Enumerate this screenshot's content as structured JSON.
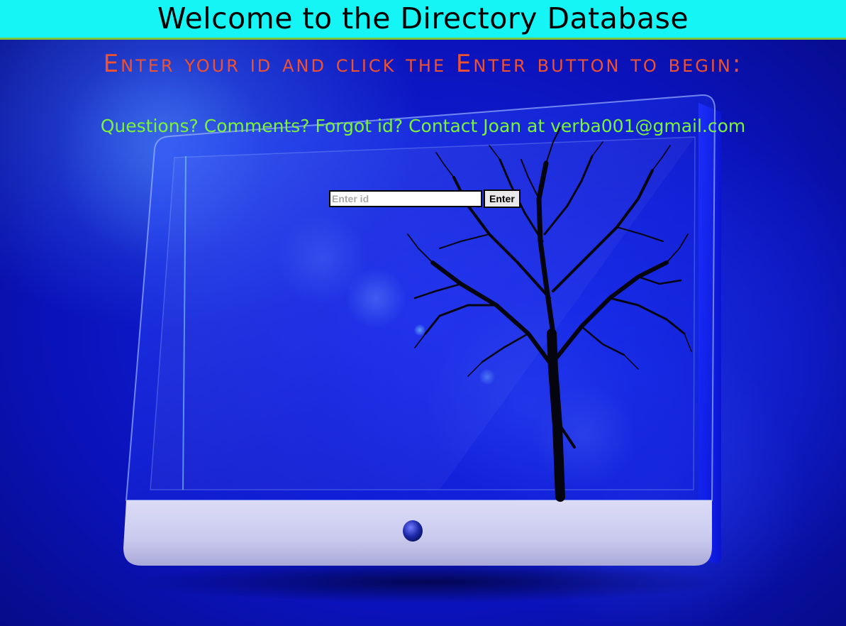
{
  "header": {
    "title": "Welcome to the Directory Database"
  },
  "instruction": {
    "text": "Enter your id and click the Enter button to begin:"
  },
  "contact": {
    "text": "Questions? Comments? Forgot id? Contact Joan at verba001@gmail.com"
  },
  "login_form": {
    "id_placeholder": "Enter id",
    "id_value": "",
    "enter_label": "Enter"
  },
  "colors": {
    "header_bg": "#16f5f5",
    "header_border": "#7cc23a",
    "instruction_text": "#f0522e",
    "contact_text": "#7cf23a",
    "background_blue": "#0b16c8"
  },
  "background": {
    "illustration": "monitor-with-bare-tree-icon"
  }
}
